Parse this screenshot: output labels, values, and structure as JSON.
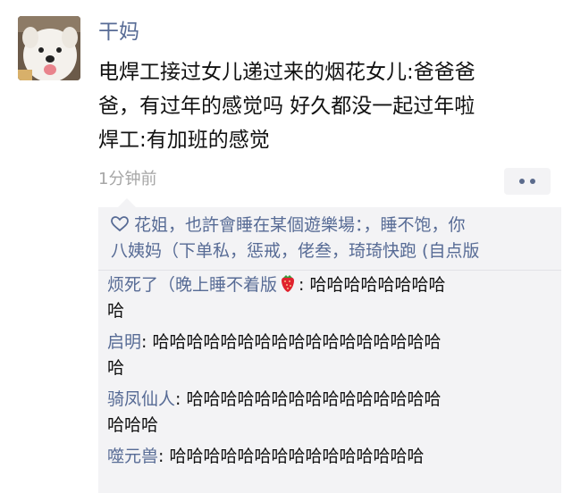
{
  "post": {
    "author": "干妈",
    "text_lines": [
      "电焊工接过女儿递过来的烟花女儿:爸爸爸",
      "爸，有过年的感觉吗 好久都没一起过年啦",
      "焊工:有加班的感觉"
    ],
    "timestamp": "1分钟前",
    "avatar_icon": "dog-avatar",
    "more_icon": "more-dots-icon"
  },
  "likes": {
    "icon": "heart-outline-icon",
    "lines": [
      "花姐，也許會睡在某個遊樂場：，睡不饱，你",
      "八姨妈（下单私，惩戒，佬叁，琦琦快跑 (自点版"
    ]
  },
  "comments": [
    {
      "name_line1": "烦死了（晚上睡不着版",
      "emoji": "strawberry-icon",
      "sep": ": ",
      "text_line1": "哈哈哈哈哈哈哈哈",
      "text_line2": "哈"
    },
    {
      "name": "启明",
      "sep": ": ",
      "text_line1": "哈哈哈哈哈哈哈哈哈哈哈哈哈哈哈哈哈",
      "text_line2": "哈"
    },
    {
      "name": "骑凤仙人",
      "sep": ": ",
      "text_line1": "哈哈哈哈哈哈哈哈哈哈哈哈哈哈哈",
      "text_line2": "哈哈哈"
    },
    {
      "name": "噬元兽",
      "sep": ": ",
      "text_line1": "哈哈哈哈哈哈哈哈哈哈哈哈哈哈哈"
    }
  ],
  "colors": {
    "link": "#576b95",
    "text": "#111111",
    "muted": "#a6a6a6",
    "comment_bg": "#f3f3f5"
  }
}
